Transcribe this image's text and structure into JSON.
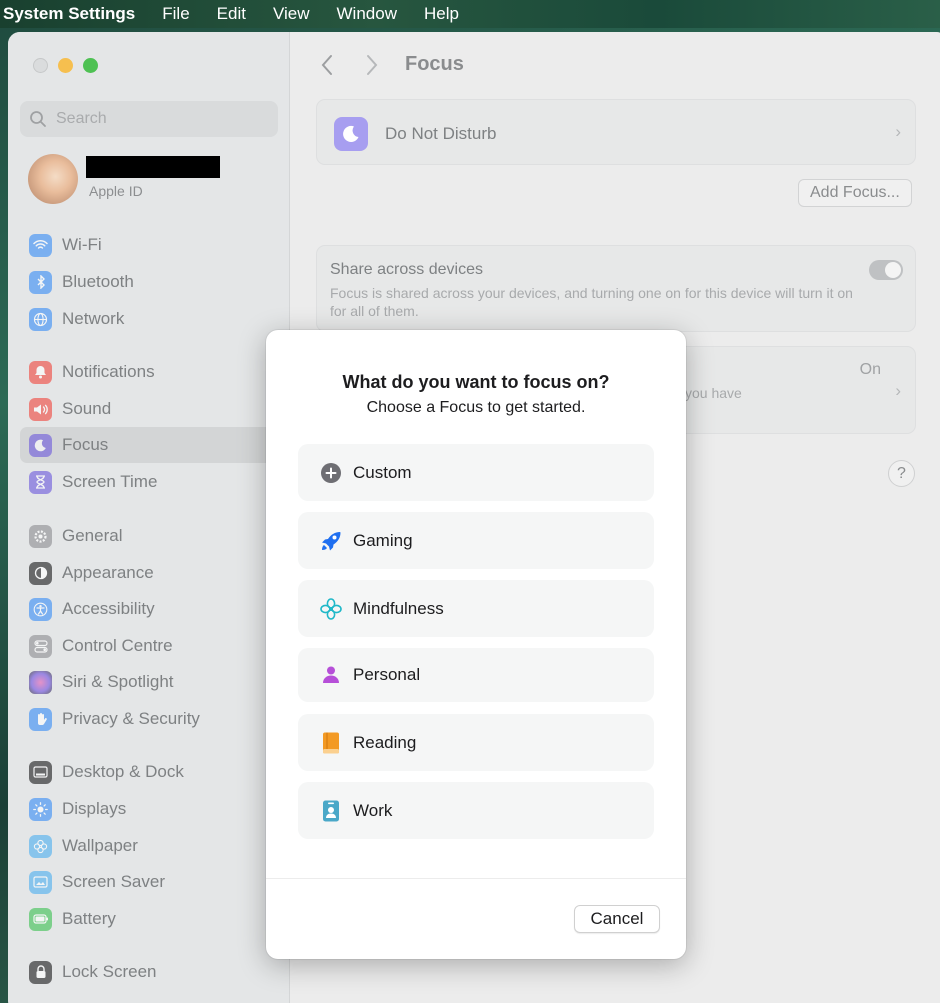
{
  "menubar": {
    "app": "System Settings",
    "items": [
      "File",
      "Edit",
      "View",
      "Window",
      "Help"
    ]
  },
  "sidebar": {
    "search_placeholder": "Search",
    "profile": {
      "subtitle": "Apple ID"
    },
    "items": [
      {
        "label": "Wi-Fi",
        "icon": "wifi-icon",
        "color": "#3a8ef6"
      },
      {
        "label": "Bluetooth",
        "icon": "bluetooth-icon",
        "color": "#3a8ef6"
      },
      {
        "label": "Network",
        "icon": "globe-icon",
        "color": "#3a8ef6"
      },
      {
        "label": "Notifications",
        "icon": "bell-icon",
        "color": "#f0473f"
      },
      {
        "label": "Sound",
        "icon": "speaker-icon",
        "color": "#f0473f"
      },
      {
        "label": "Focus",
        "icon": "moon-icon",
        "color": "#6e5bdc"
      },
      {
        "label": "Screen Time",
        "icon": "hourglass-icon",
        "color": "#6e5bdc"
      },
      {
        "label": "General",
        "icon": "gear-icon",
        "color": "#8e8e93"
      },
      {
        "label": "Appearance",
        "icon": "appearance-icon",
        "color": "#1d1d1f"
      },
      {
        "label": "Accessibility",
        "icon": "accessibility-icon",
        "color": "#3a8ef6"
      },
      {
        "label": "Control Centre",
        "icon": "control-centre-icon",
        "color": "#8e8e93"
      },
      {
        "label": "Siri & Spotlight",
        "icon": "siri-icon",
        "color": "#b050d0"
      },
      {
        "label": "Privacy & Security",
        "icon": "hand-icon",
        "color": "#3a8ef6"
      },
      {
        "label": "Desktop & Dock",
        "icon": "dock-icon",
        "color": "#1d1d1f"
      },
      {
        "label": "Displays",
        "icon": "sun-icon",
        "color": "#3a8ef6"
      },
      {
        "label": "Wallpaper",
        "icon": "flower-icon",
        "color": "#4fb0f0"
      },
      {
        "label": "Screen Saver",
        "icon": "screensaver-icon",
        "color": "#4fb0f0"
      },
      {
        "label": "Battery",
        "icon": "battery-icon",
        "color": "#3dc154"
      },
      {
        "label": "Lock Screen",
        "icon": "lock-icon",
        "color": "#1d1d1f"
      }
    ]
  },
  "main": {
    "title": "Focus",
    "dnd_label": "Do Not Disturb",
    "add_focus": "Add Focus...",
    "share_title": "Share across devices",
    "share_desc": "Focus is shared across your devices, and turning one on for this device will turn it on for all of them.",
    "status_on": "On",
    "status_desc_fragment": "you have",
    "help": "?"
  },
  "modal": {
    "title": "What do you want to focus on?",
    "subtitle": "Choose a Focus to get started.",
    "options": [
      {
        "label": "Custom",
        "icon": "plus-circle-icon",
        "color": "#6e6e73"
      },
      {
        "label": "Gaming",
        "icon": "rocket-icon",
        "color": "#1f6ff0"
      },
      {
        "label": "Mindfulness",
        "icon": "flower-icon",
        "color": "#1fb8c8"
      },
      {
        "label": "Personal",
        "icon": "person-icon",
        "color": "#b64fd8"
      },
      {
        "label": "Reading",
        "icon": "book-icon",
        "color": "#f39a24"
      },
      {
        "label": "Work",
        "icon": "badge-icon",
        "color": "#4aa8c8"
      }
    ],
    "cancel": "Cancel"
  }
}
